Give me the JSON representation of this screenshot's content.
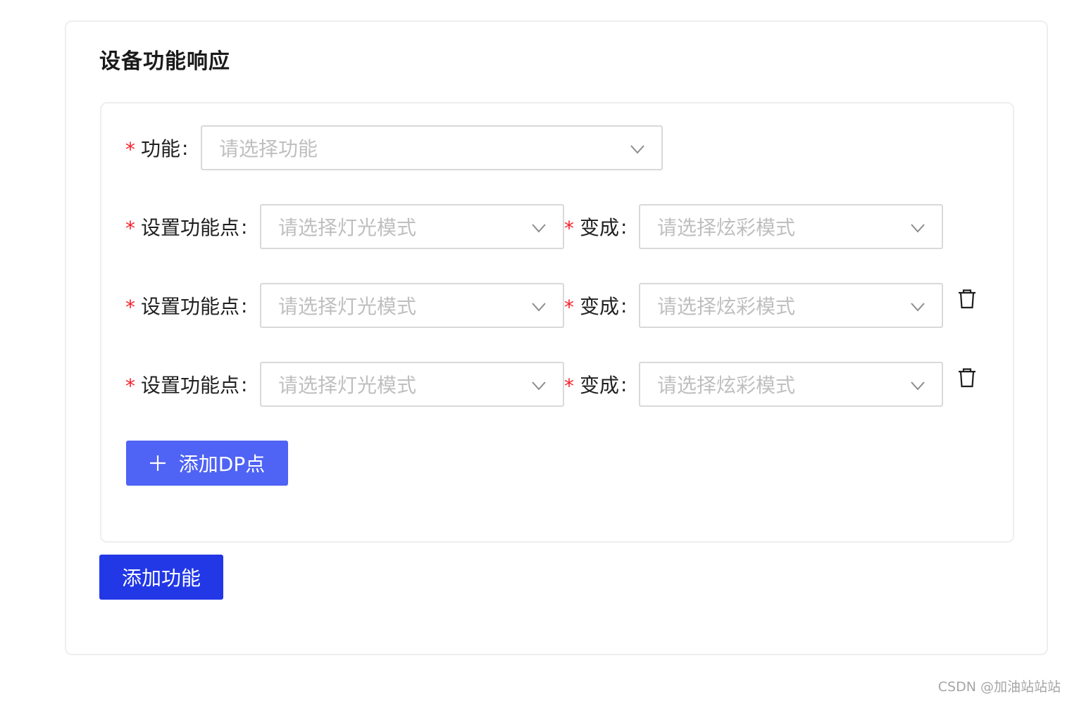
{
  "section": {
    "title": "设备功能响应"
  },
  "function_row": {
    "required_mark": "*",
    "label": "功能",
    "colon": ":",
    "placeholder": "请选择功能"
  },
  "dp_rows": [
    {
      "required_mark": "*",
      "label": "设置功能点",
      "colon": ":",
      "mode_placeholder": "请选择灯光模式",
      "target_required_mark": "*",
      "target_label": "变成",
      "target_colon": ":",
      "target_placeholder": "请选择炫彩模式",
      "deletable": false
    },
    {
      "required_mark": "*",
      "label": "设置功能点",
      "colon": ":",
      "mode_placeholder": "请选择灯光模式",
      "target_required_mark": "*",
      "target_label": "变成",
      "target_colon": ":",
      "target_placeholder": "请选择炫彩模式",
      "deletable": true
    },
    {
      "required_mark": "*",
      "label": "设置功能点",
      "colon": ":",
      "mode_placeholder": "请选择灯光模式",
      "target_required_mark": "*",
      "target_label": "变成",
      "target_colon": ":",
      "target_placeholder": "请选择炫彩模式",
      "deletable": true
    }
  ],
  "buttons": {
    "add_dp": "添加DP点",
    "add_function": "添加功能"
  },
  "icons": {
    "select_arrow": "chevron-down-icon",
    "delete": "trash-icon",
    "add": "plus-icon"
  },
  "colors": {
    "required": "#f5222d",
    "add_dp_button": "#4f63f5",
    "add_function_button": "#2238e6",
    "placeholder": "#bfbfbf",
    "border": "#d9d9d9"
  },
  "watermark": "CSDN @加油站站站"
}
